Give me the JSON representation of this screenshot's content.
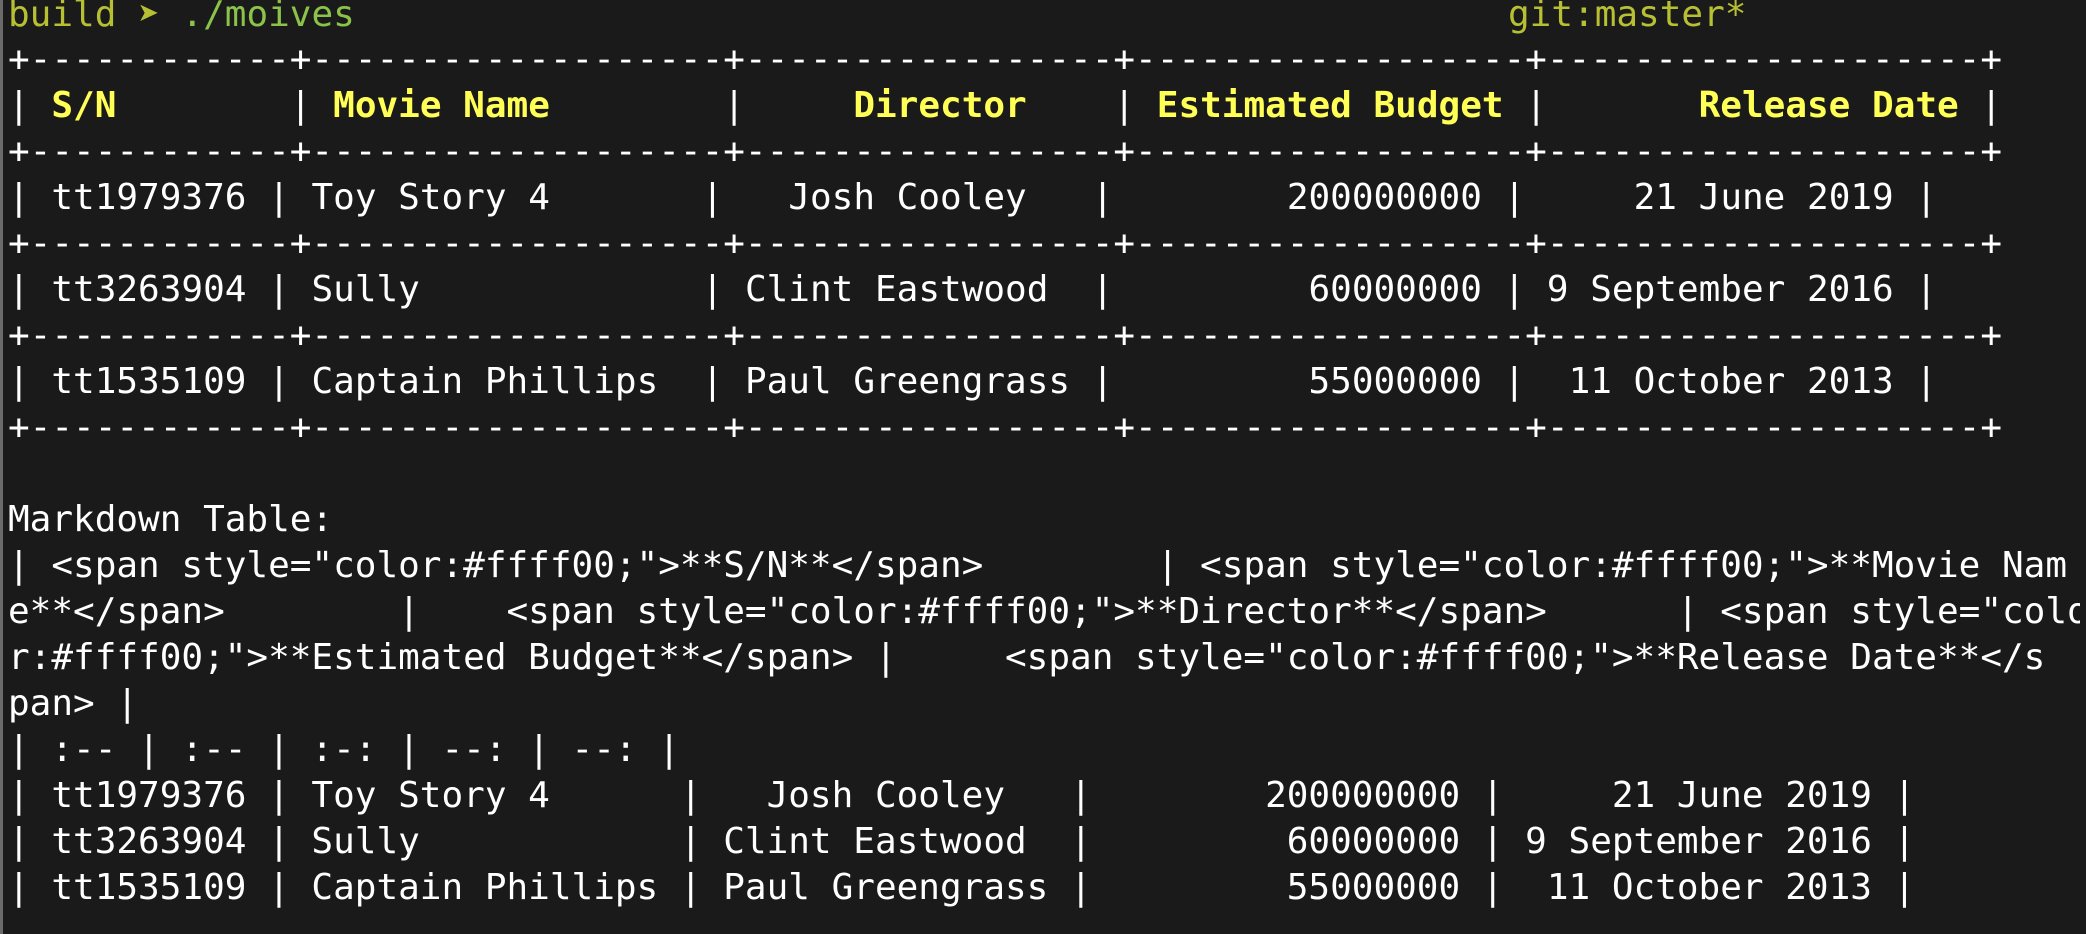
{
  "prompt": {
    "dir": "build",
    "arrow": "➤",
    "command": "./moives",
    "git": "git:master*"
  },
  "table": {
    "border": "+------------+-------------------+-----------------+------------------+--------------------+",
    "header_cells": [
      "S/N",
      "Movie Name",
      "Director",
      "Estimated Budget",
      "Release Date"
    ],
    "row_1": [
      "tt1979376",
      "Toy Story 4",
      "Josh Cooley",
      "200000000",
      "21 June 2019"
    ],
    "row_2": [
      "tt3263904",
      "Sully",
      "Clint Eastwood",
      "60000000",
      "9 September 2016"
    ],
    "row_3": [
      "tt1535109",
      "Captain Phillips",
      "Paul Greengrass",
      "55000000",
      "11 October 2013"
    ]
  },
  "markdown": {
    "label": "Markdown Table:",
    "header_lines": [
      "| <span style=\"color:#ffff00;\">**S/N**</span>        | <span style=\"color:#ffff00;\">**Movie Nam",
      "e**</span>        |    <span style=\"color:#ffff00;\">**Director**</span>      | <span style=\"colo",
      "r:#ffff00;\">**Estimated Budget**</span> |     <span style=\"color:#ffff00;\">**Release Date**</s",
      "pan> |"
    ],
    "align_line": "| :-- | :-- | :-: | --: | --: |",
    "rows": [
      "| tt1979376 | Toy Story 4      |   Josh Cooley   |        200000000 |     21 June 2019 |",
      "| tt3263904 | Sully            | Clint Eastwood  |         60000000 | 9 September 2016 |",
      "| tt1535109 | Captain Phillips | Paul Greengrass |         55000000 |  11 October 2013 |"
    ]
  },
  "colors": {
    "background": "#1a1a1a",
    "text": "#ffffff",
    "header": "#ffff55",
    "prompt": "#b7c033"
  }
}
